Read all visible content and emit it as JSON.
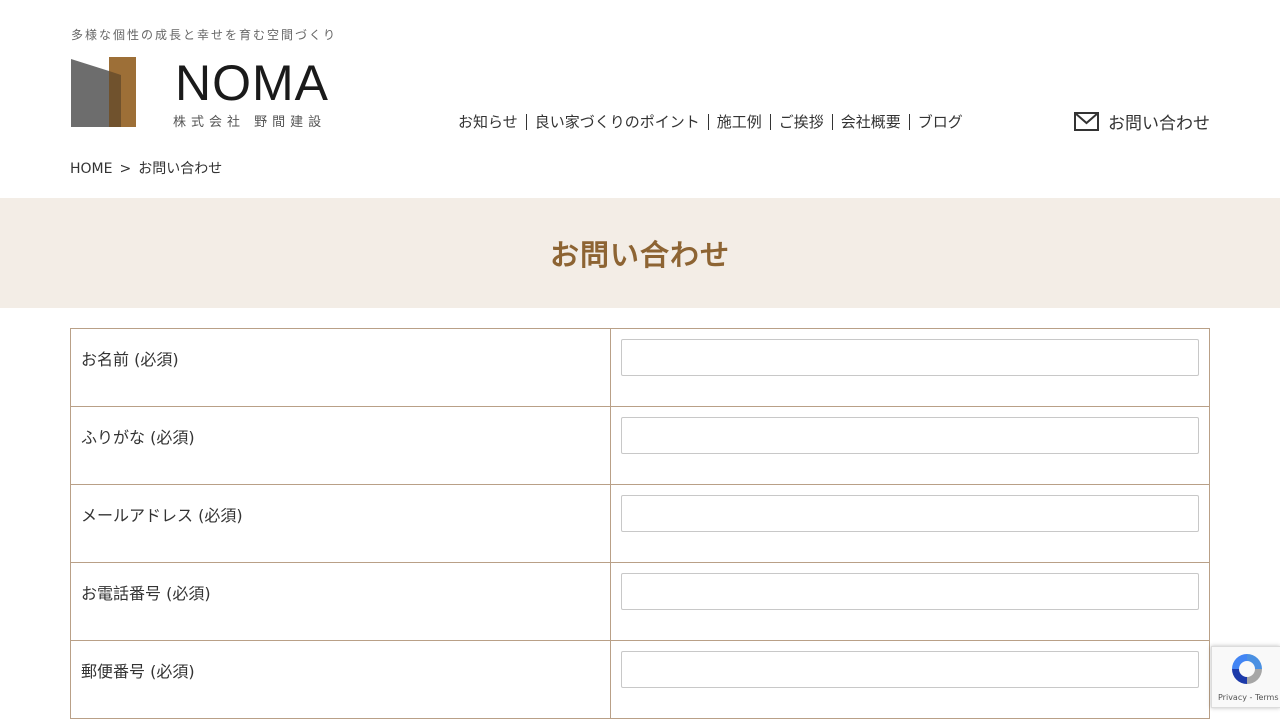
{
  "header": {
    "tagline": "多様な個性の成長と幸せを育む空間づくり",
    "logo_name": "NOMA",
    "logo_sub": "株式会社 野間建設"
  },
  "nav": {
    "items": [
      {
        "label": "お知らせ"
      },
      {
        "label": "良い家づくりのポイント"
      },
      {
        "label": "施工例"
      },
      {
        "label": "ご挨拶"
      },
      {
        "label": "会社概要"
      },
      {
        "label": "ブログ"
      }
    ],
    "contact_label": "お問い合わせ",
    "contact_icon": "mail-icon"
  },
  "breadcrumb": {
    "home": "HOME",
    "separator": ">",
    "current": "お問い合わせ"
  },
  "page_title": "お問い合わせ",
  "form": {
    "rows": [
      {
        "label": "お名前 (必須)",
        "value": ""
      },
      {
        "label": "ふりがな (必須)",
        "value": ""
      },
      {
        "label": "メールアドレス (必須)",
        "value": ""
      },
      {
        "label": "お電話番号 (必須)",
        "value": ""
      },
      {
        "label": "郵便番号 (必須)",
        "value": ""
      }
    ]
  },
  "recaptcha": {
    "text": "Privacy - Terms"
  },
  "colors": {
    "accent": "#8d6433",
    "banner_bg": "#f3ede6",
    "table_border": "#b9a087"
  }
}
